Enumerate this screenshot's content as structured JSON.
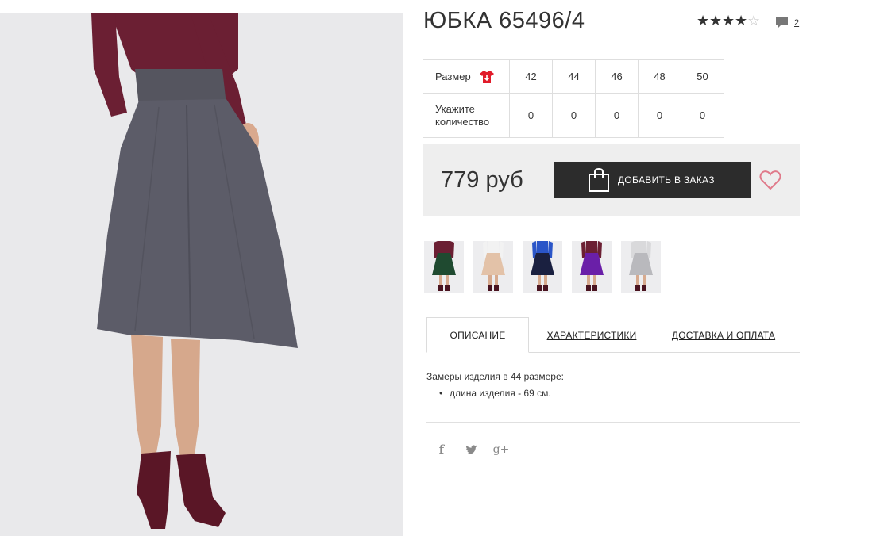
{
  "product": {
    "title": "ЮБКА 65496/4",
    "rating": {
      "value": 4,
      "max": 5
    },
    "comments_count": "2",
    "price": "779 руб",
    "add_to_order_label": "ДОБАВИТЬ В ЗАКАЗ"
  },
  "size_table": {
    "size_label": "Размер",
    "quantity_label": "Укажите количество",
    "sizes": [
      "42",
      "44",
      "46",
      "48",
      "50"
    ],
    "quantities": [
      "0",
      "0",
      "0",
      "0",
      "0"
    ]
  },
  "thumbnails": [
    {
      "name": "thumb-green",
      "skirt_color": "#1f4a30",
      "top_color": "#6b1f33"
    },
    {
      "name": "thumb-beige",
      "skirt_color": "#e3c2a8",
      "top_color": "#f2f2f2"
    },
    {
      "name": "thumb-navy",
      "skirt_color": "#1a2040",
      "top_color": "#2a55c8"
    },
    {
      "name": "thumb-purple",
      "skirt_color": "#6a1fa8",
      "top_color": "#6b1f33"
    },
    {
      "name": "thumb-grey",
      "skirt_color": "#b9b9bd",
      "top_color": "#d9d9db"
    }
  ],
  "tabs": [
    {
      "label": "ОПИСАНИЕ",
      "active": true
    },
    {
      "label": "ХАРАКТЕРИСТИКИ",
      "active": false
    },
    {
      "label": "ДОСТАВКА И ОПЛАТА",
      "active": false
    }
  ],
  "description": {
    "intro": "Замеры изделия в 44 размере:",
    "items": [
      "длина изделия - 69 см."
    ]
  },
  "social": [
    {
      "icon": "facebook-icon",
      "glyph": "f"
    },
    {
      "icon": "twitter-icon",
      "glyph": "t"
    },
    {
      "icon": "google-plus-icon",
      "glyph": "g+"
    }
  ],
  "colors": {
    "button_bg": "#2c2c2c",
    "price_box_bg": "#eeeeee",
    "heart": "#e07a8a",
    "tshirt_icon": "#e11b2a",
    "main_skirt": "#5c5c68",
    "main_top": "#6b1f33"
  }
}
